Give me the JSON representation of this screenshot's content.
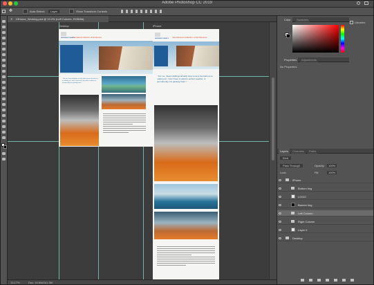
{
  "app": {
    "title": "Adobe Photoshop CC 2019",
    "document_tab": "13Home_Working.psd @ 13.2% (Left Column, RGB/8#)",
    "traffic_colors": [
      "#ff5f57",
      "#febc2e",
      "#28c840"
    ]
  },
  "options_bar": {
    "auto_select_label": "Auto-Select:",
    "auto_select_value": "Layer",
    "transform_controls_label": "Show Transform Controls"
  },
  "status": {
    "zoom": "13.17%",
    "doc_info": "Doc: 16.6M/241.3M"
  },
  "artboards": {
    "desktop_label": "Desktop",
    "iphone_label": "iPhone",
    "brand": "MERIDIAN PLANETS",
    "subtitle": "International Collection of Architecture",
    "quote": "“ For me, these buildings actually help remove the barriers to making art. I don't have to wait for perfect weather, or permanently mix painting heart.”"
  },
  "panels": {
    "color": {
      "tab_color": "Color",
      "tab_swatches": "Swatches",
      "fg_color": "#ffffff",
      "bg_color": "#000000"
    },
    "properties": {
      "tab_properties": "Properties",
      "tab_adjustments": "Adjustments",
      "empty": "No Properties"
    },
    "layers": {
      "tab_layers": "Layers",
      "tab_channels": "Channels",
      "tab_paths": "Paths",
      "filter_label": "Kind",
      "blend_mode": "Pass Through",
      "opacity_label": "Opacity:",
      "opacity_value": "100%",
      "lock_label": "Lock:",
      "fill_label": "Fill:",
      "fill_value": "100%",
      "items": [
        {
          "name": "iPhone",
          "kind": "artboard",
          "indent": 0,
          "selected": false
        },
        {
          "name": "Bottom img",
          "kind": "folder",
          "indent": 1,
          "selected": false
        },
        {
          "name": "LOGO",
          "kind": "layer",
          "indent": 1,
          "selected": false
        },
        {
          "name": "Banner img",
          "kind": "layer",
          "indent": 1,
          "selected": false
        },
        {
          "name": "Left Column",
          "kind": "folder",
          "indent": 1,
          "selected": true
        },
        {
          "name": "Right Column",
          "kind": "folder",
          "indent": 1,
          "selected": false
        },
        {
          "name": "Layer 0",
          "kind": "layer",
          "indent": 1,
          "selected": false
        },
        {
          "name": "Desktop",
          "kind": "artboard",
          "indent": 0,
          "selected": false
        }
      ]
    },
    "libraries_label": "Libraries"
  }
}
